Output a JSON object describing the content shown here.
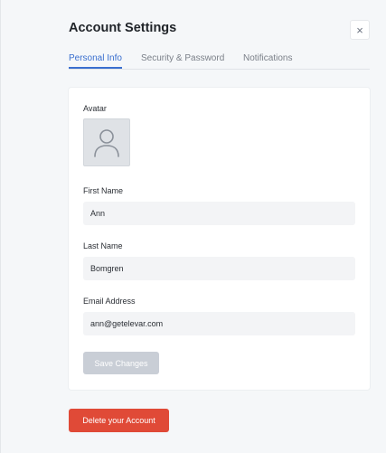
{
  "dialog": {
    "title": "Account Settings",
    "close_icon": "close-icon",
    "close_glyph": "×"
  },
  "tabs": [
    {
      "label": "Personal Info",
      "active": true
    },
    {
      "label": "Security & Password",
      "active": false
    },
    {
      "label": "Notifications",
      "active": false
    }
  ],
  "form": {
    "avatar": {
      "label": "Avatar",
      "icon": "user-placeholder-icon"
    },
    "first_name": {
      "label": "First Name",
      "value": "Ann"
    },
    "last_name": {
      "label": "Last Name",
      "value": "Bomgren"
    },
    "email": {
      "label": "Email Address",
      "value": "ann@getelevar.com"
    },
    "save_label": "Save Changes"
  },
  "danger": {
    "delete_label": "Delete your Account"
  },
  "colors": {
    "accent": "#3a6fcf",
    "danger": "#e04a37",
    "disabled_button": "#c9ced6"
  }
}
